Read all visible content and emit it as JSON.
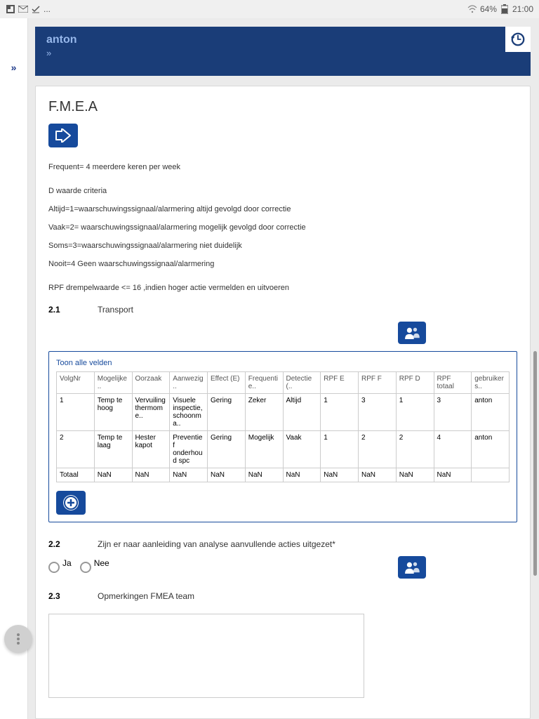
{
  "status": {
    "battery": "64%",
    "time": "21:00",
    "ellipsis": "..."
  },
  "header": {
    "title": "anton",
    "sub": "»",
    "leftChev": "»"
  },
  "page": {
    "title": "F.M.E.A",
    "info": [
      "Frequent= 4 meerdere keren per week",
      "D waarde criteria",
      "Altijd=1=waarschuwingssignaal/alarmering altijd gevolgd door correctie",
      "Vaak=2= waarschuwingssignaal/alarmering mogelijk gevolgd door correctie",
      "Soms=3=waarschuwingssignaal/alarmering niet duidelijk",
      "Nooit=4 Geen waarschuwingssignaal/alarmering",
      "RPF drempelwaarde <= 16 ,indien hoger actie vermelden en uitvoeren"
    ],
    "s21_num": "2.1",
    "s21_label": "Transport",
    "s22_num": "2.2",
    "s22_label": "Zijn er naar aanleiding van analyse aanvullende acties uitgezet*",
    "s23_num": "2.3",
    "s23_label": "Opmerkingen FMEA team",
    "radio_ja": "Ja",
    "radio_nee": "Nee",
    "show_all": "Toon alle velden",
    "table": {
      "headers": [
        "VolgNr",
        "Mogelijke ..",
        "Oorzaak",
        "Aanwezig..",
        "Effect (E)",
        "Frequentie..",
        "Detectie (..",
        "RPF E",
        "RPF F",
        "RPF D",
        "RPF totaal",
        "gebruikers.."
      ],
      "rows": [
        [
          "1",
          "Temp te hoog",
          "Vervuiling thermome..",
          "Visuele inspectie, schoonma..",
          "Gering",
          "Zeker",
          "Altijd",
          "1",
          "3",
          "1",
          "3",
          "anton"
        ],
        [
          "2",
          "Temp te laag",
          "Hester kapot",
          "Preventief onderhoud spc",
          "Gering",
          "Mogelijk",
          "Vaak",
          "1",
          "2",
          "2",
          "4",
          "anton"
        ],
        [
          "Totaal",
          "NaN",
          "NaN",
          "NaN",
          "NaN",
          "NaN",
          "NaN",
          "NaN",
          "NaN",
          "NaN",
          "NaN",
          ""
        ]
      ]
    }
  }
}
